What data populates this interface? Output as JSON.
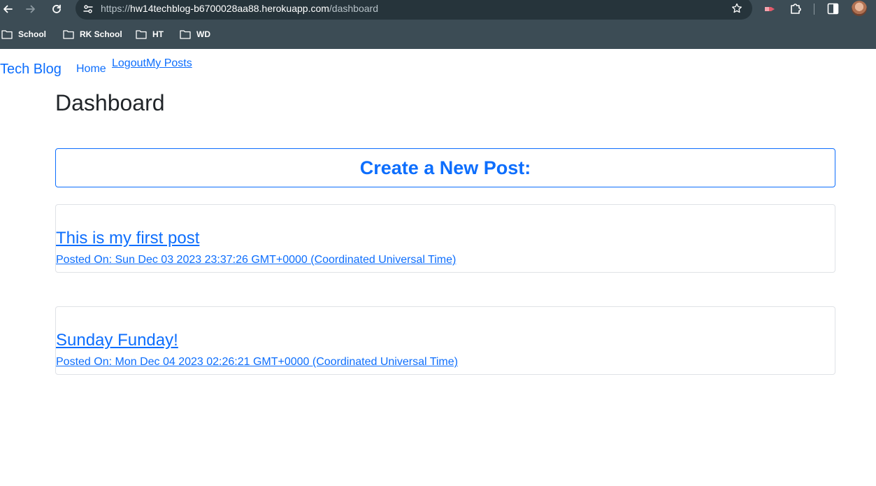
{
  "browser": {
    "url_prefix": "https://",
    "url_host": "hw14techblog-b6700028aa88.herokuapp.com",
    "url_path": "/dashboard",
    "bookmarks": [
      {
        "label": "School"
      },
      {
        "label": "RK School"
      },
      {
        "label": "HT"
      },
      {
        "label": "WD"
      }
    ]
  },
  "nav": {
    "brand": "Tech Blog",
    "home": "Home",
    "logout": "Logout",
    "my_posts": "My Posts"
  },
  "main": {
    "title": "Dashboard",
    "create_post": "Create a New Post:",
    "posts": [
      {
        "title": "This is my first post",
        "posted_on": "Posted On: Sun Dec 03 2023 23:37:26 GMT+0000 (Coordinated Universal Time)"
      },
      {
        "title": "Sunday Funday!",
        "posted_on": "Posted On: Mon Dec 04 2023 02:26:21 GMT+0000 (Coordinated Universal Time)"
      }
    ]
  },
  "colors": {
    "link": "#0d6efd",
    "heading": "#212529",
    "chrome": "#3c4c55",
    "card_border": "#dfe2e6"
  }
}
